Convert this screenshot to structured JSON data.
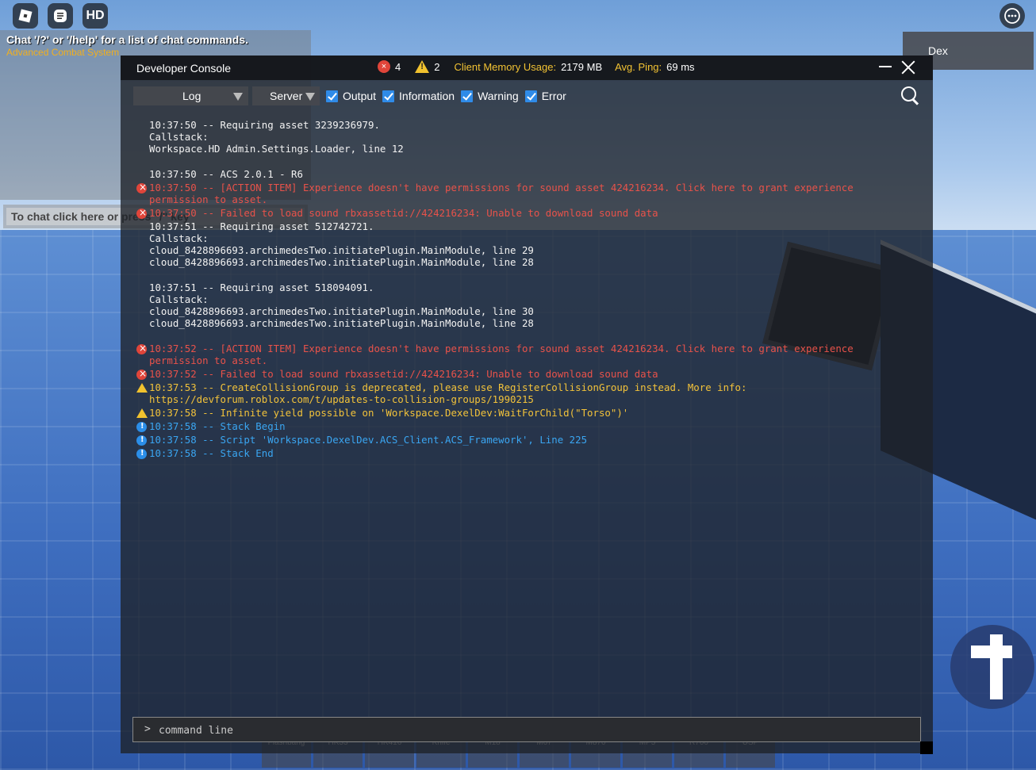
{
  "topbar": {
    "menu_icon": "roblox-logo-icon",
    "chat_icon": "chat-icon",
    "hd_label": "HD",
    "more_icon": "more-options-icon"
  },
  "chat": {
    "system_message": "Chat '/?' or '/help' for a list of chat commands.",
    "system_tag": "Advanced Combat System",
    "input_placeholder": "To chat click here or press \"/\" key"
  },
  "dex": {
    "label": "Dex"
  },
  "console": {
    "title": "Developer Console",
    "error_count": "4",
    "warning_count": "2",
    "memory_label": "Client Memory Usage:",
    "memory_value": "2179 MB",
    "ping_label": "Avg. Ping:",
    "ping_value": "69 ms",
    "view_dropdown": "Log",
    "context_dropdown": "Server",
    "filters": {
      "output": "Output",
      "information": "Information",
      "warning": "Warning",
      "error": "Error"
    },
    "log": [
      {
        "type": "output",
        "text": "10:37:50 -- Requiring asset 3239236979."
      },
      {
        "type": "output",
        "text": "Callstack:"
      },
      {
        "type": "output",
        "text": "Workspace.HD Admin.Settings.Loader, line 12"
      },
      {
        "type": "output",
        "text": "10:37:50 -- ACS 2.0.1 - R6"
      },
      {
        "type": "error",
        "text": "10:37:50 -- [ACTION ITEM] Experience doesn't have permissions for sound asset 424216234. Click here to grant experience"
      },
      {
        "type": "error",
        "text": "permission to asset."
      },
      {
        "type": "error",
        "text": "10:37:50 -- Failed to load sound rbxassetid://424216234: Unable to download sound data"
      },
      {
        "type": "output",
        "text": "10:37:51 -- Requiring asset 512742721."
      },
      {
        "type": "output",
        "text": "Callstack:"
      },
      {
        "type": "output",
        "text": "cloud_8428896693.archimedesTwo.initiatePlugin.MainModule, line 29"
      },
      {
        "type": "output",
        "text": "cloud_8428896693.archimedesTwo.initiatePlugin.MainModule, line 28"
      },
      {
        "type": "output",
        "text": "10:37:51 -- Requiring asset 518094091."
      },
      {
        "type": "output",
        "text": "Callstack:"
      },
      {
        "type": "output",
        "text": "cloud_8428896693.archimedesTwo.initiatePlugin.MainModule, line 30"
      },
      {
        "type": "output",
        "text": "cloud_8428896693.archimedesTwo.initiatePlugin.MainModule, line 28"
      },
      {
        "type": "error",
        "text": "10:37:52 -- [ACTION ITEM] Experience doesn't have permissions for sound asset 424216234. Click here to grant experience"
      },
      {
        "type": "error",
        "text": "permission to asset."
      },
      {
        "type": "error",
        "text": "10:37:52 -- Failed to load sound rbxassetid://424216234: Unable to download sound data"
      },
      {
        "type": "warning",
        "text": "10:37:53 -- CreateCollisionGroup is deprecated, please use RegisterCollisionGroup instead. More info:"
      },
      {
        "type": "warning",
        "text": "https://devforum.roblox.com/t/updates-to-collision-groups/1990215"
      },
      {
        "type": "warning",
        "text": "10:37:58 -- Infinite yield possible on 'Workspace.DexelDev:WaitForChild(\"Torso\")'"
      },
      {
        "type": "info",
        "text": "10:37:58 -- Stack Begin"
      },
      {
        "type": "info",
        "text": "10:37:58 -- Script 'Workspace.DexelDev.ACS_Client.ACS_Framework', Line 225"
      },
      {
        "type": "info",
        "text": "10:37:58 -- Stack End"
      }
    ],
    "command_prompt": ">",
    "command_placeholder": "command line"
  },
  "hotbar": [
    "Flashbang",
    "HK33",
    "HK416",
    "Knife",
    "M18",
    "M67",
    "M870",
    "MP5",
    "R700",
    "USP"
  ],
  "colors": {
    "error": "#e8524a",
    "warning": "#f2c23a",
    "info": "#3aa6f2",
    "checkbox": "#2f8be8"
  }
}
